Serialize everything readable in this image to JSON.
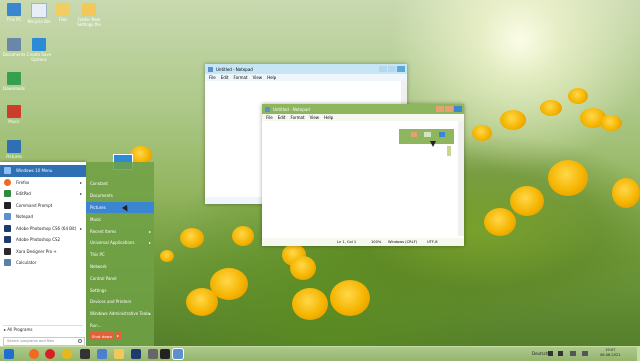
{
  "desktop_icons": [
    {
      "label": "This PC",
      "color": "#3b86d1"
    },
    {
      "label": "Recycle Bin",
      "color": "#e8eef5"
    },
    {
      "label": "Files",
      "color": "#f2cd62"
    },
    {
      "label": "Folder New Settings file",
      "color": "#f2c85a"
    },
    {
      "label": "Documents",
      "color": "#6a87a8"
    },
    {
      "label": "Create Save Options",
      "color": "#2c8bd6"
    },
    {
      "label": "Downloads",
      "color": "#36a050"
    },
    {
      "label": "Music",
      "color": "#cc3b2e"
    },
    {
      "label": "Pictures",
      "color": "#2f6fb3"
    }
  ],
  "notepad_back": {
    "title": "Untitled - Notepad",
    "menu": [
      "File",
      "Edit",
      "Format",
      "View",
      "Help"
    ]
  },
  "notepad_front": {
    "title": "Untitled - Notepad",
    "menu": [
      "File",
      "Edit",
      "Format",
      "View",
      "Help"
    ],
    "status": {
      "position": "Ln 1, Col 1",
      "zoom": "100%",
      "line_ending": "Windows (CRLF)",
      "encoding": "UTF-8"
    }
  },
  "start_menu": {
    "programs": [
      {
        "label": "Windows 10 Menu",
        "color": "#1f5fb0"
      },
      {
        "label": "Firefox",
        "color": "#ef6a1f",
        "arrow": "▸"
      },
      {
        "label": "EditPad",
        "color": "#2d8a3e",
        "arrow": "▸"
      },
      {
        "label": "Command Prompt",
        "color": "#222222"
      },
      {
        "label": "Notepad",
        "color": "#5b8fd0"
      },
      {
        "label": "Adobe Photoshop CS6 (64 Bit)",
        "color": "#1d3b6e",
        "arrow": "▸"
      },
      {
        "label": "Adobe Photoshop CS2",
        "color": "#1d3b6e"
      },
      {
        "label": "Xara Designer Pro +",
        "color": "#2a2a2a"
      },
      {
        "label": "Calculator",
        "color": "#5a7fa8"
      }
    ],
    "all_programs": "All Programs",
    "search_placeholder": "Search programs and files",
    "right_items": [
      {
        "label": "Constant"
      },
      {
        "label": "Documents"
      },
      {
        "label": "Pictures"
      },
      {
        "label": "Music"
      },
      {
        "label": "Recent Items",
        "arrow": "▸"
      },
      {
        "label": "Universal Applications",
        "arrow": "▸"
      },
      {
        "label": "This PC"
      },
      {
        "label": "Network"
      },
      {
        "label": "Control Panel"
      },
      {
        "label": "Settings"
      },
      {
        "label": "Devices and Printers"
      },
      {
        "label": "Windows Administrative Tools",
        "arrow": "▸"
      },
      {
        "label": "Run..."
      }
    ],
    "shutdown": "Shut down",
    "shutdown_arrow": "▸"
  },
  "taskbar": {
    "apps": [
      {
        "name": "start-button",
        "color": "#1f6fd0"
      },
      {
        "name": "firefox-taskbar-icon",
        "color": "#ef6a1f"
      },
      {
        "name": "opera-taskbar-icon",
        "color": "#d81f26"
      },
      {
        "name": "chrome-taskbar-icon",
        "color": "#e8b81a"
      },
      {
        "name": "media-taskbar-icon",
        "color": "#333333"
      },
      {
        "name": "store-taskbar-icon",
        "color": "#4b7fd0"
      },
      {
        "name": "explorer-taskbar-icon",
        "color": "#f2c85a"
      },
      {
        "name": "photoshop-taskbar-icon",
        "color": "#1d3b6e"
      },
      {
        "name": "app-taskbar-icon",
        "color": "#666666"
      },
      {
        "name": "terminal-taskbar-icon",
        "color": "#222222"
      },
      {
        "name": "notepad-taskbar-icon",
        "color": "#5b8fd0"
      }
    ],
    "language": "Deutsch",
    "time": "19:07",
    "date": "06.06.2021"
  }
}
